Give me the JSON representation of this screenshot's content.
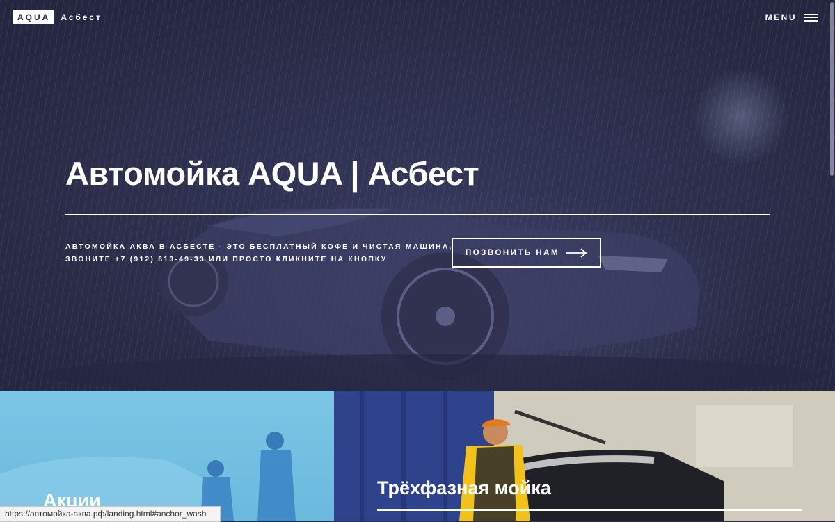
{
  "header": {
    "logo_box": "AQUA",
    "logo_text": "Асбест",
    "menu_label": "MENU"
  },
  "hero": {
    "title": "Автомойка AQUA | Асбест",
    "description_line1": "АВТОМОЙКА АКВА В АСБЕСТЕ - ЭТО БЕСПЛАТНЫЙ КОФЕ И ЧИСТАЯ МАШИНА.",
    "description_line2": "ЗВОНИТЕ +7 (912) 613-49-33 ИЛИ ПРОСТО КЛИКНИТЕ НА КНОПКУ",
    "call_button": "ПОЗВОНИТЬ НАМ"
  },
  "panels": [
    {
      "title": "Акции"
    },
    {
      "title": "Трёхфазная мойка"
    }
  ],
  "status_bar": {
    "url": "https://автомойка-аква.рф/landing.html#anchor_wash"
  },
  "icons": {
    "menu": "hamburger-icon",
    "call_arrow": "arrow-right-icon"
  },
  "colors": {
    "hero_overlay": "#2b2d4a",
    "text": "#ffffff",
    "left_panel": "#6ab9dd",
    "right_panel_curtain": "#2d3f88",
    "worker_uniform": "#f2c21a",
    "worker_cap": "#e07a1e"
  }
}
